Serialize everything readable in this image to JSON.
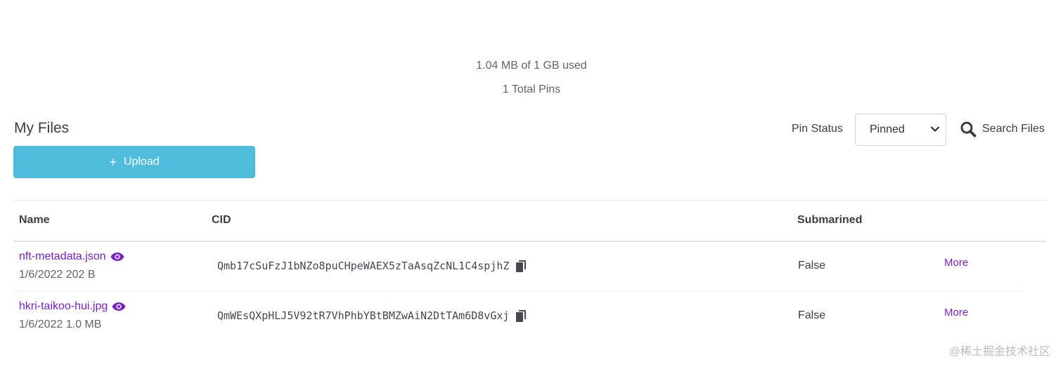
{
  "usage": {
    "used_text": "1.04 MB of 1 GB used",
    "pins_text": "1 Total Pins"
  },
  "header": {
    "title": "My Files",
    "upload_label": "Upload",
    "pin_status_label": "Pin Status",
    "pin_status_value": "Pinned",
    "search_label": "Search Files"
  },
  "table": {
    "columns": [
      "Name",
      "CID",
      "Submarined"
    ],
    "rows": [
      {
        "name": "nft-metadata.json",
        "meta": "1/6/2022 202 B",
        "cid": "Qmb17cSuFzJ1bNZo8puCHpeWAEX5zTaAsqZcNL1C4spjhZ",
        "submarined": "False",
        "more": "More"
      },
      {
        "name": "hkri-taikoo-hui.jpg",
        "meta": "1/6/2022 1.0 MB",
        "cid": "QmWEsQXpHLJ5V92tR7VhPhbYBtBMZwAiN2DtTAm6D8vGxj",
        "submarined": "False",
        "more": "More"
      }
    ]
  },
  "watermark": "@稀土掘金技术社区",
  "colors": {
    "accent_purple": "#7b1fc9",
    "upload_button": "#4fbcdc"
  },
  "icons": [
    "plus-icon",
    "chevron-down-icon",
    "search-icon",
    "eye-icon",
    "copy-icon"
  ]
}
